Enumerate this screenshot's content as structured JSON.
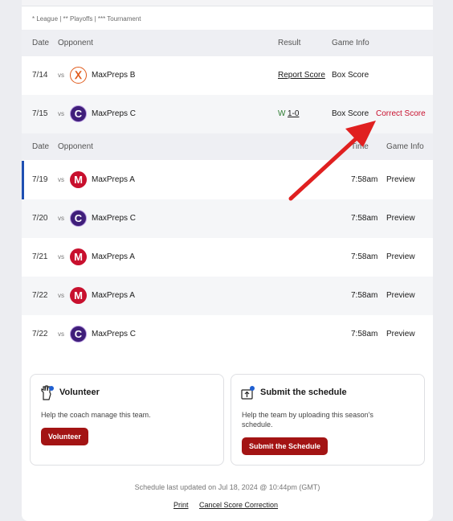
{
  "legend": "* League | ** Playoffs | *** Tournament",
  "results_header": {
    "date": "Date",
    "opponent": "Opponent",
    "result": "Result",
    "game_info": "Game Info"
  },
  "results": [
    {
      "date": "7/14",
      "vs": "vs",
      "opponent": "MaxPreps B",
      "result_link": "Report Score",
      "box": "Box Score"
    },
    {
      "date": "7/15",
      "vs": "vs",
      "opponent": "MaxPreps C",
      "result_prefix": "W",
      "result_score": "1-0",
      "box": "Box Score",
      "correct": "Correct Score"
    }
  ],
  "upcoming_header": {
    "date": "Date",
    "opponent": "Opponent",
    "time": "Time",
    "game_info": "Game Info"
  },
  "upcoming": [
    {
      "date": "7/19",
      "vs": "vs",
      "opponent": "MaxPreps A",
      "logo": "M",
      "time": "7:58am",
      "info": "Preview"
    },
    {
      "date": "7/20",
      "vs": "vs",
      "opponent": "MaxPreps C",
      "logo": "C",
      "time": "7:58am",
      "info": "Preview"
    },
    {
      "date": "7/21",
      "vs": "vs",
      "opponent": "MaxPreps A",
      "logo": "M",
      "time": "7:58am",
      "info": "Preview"
    },
    {
      "date": "7/22",
      "vs": "vs",
      "opponent": "MaxPreps A",
      "logo": "M",
      "time": "7:58am",
      "info": "Preview"
    },
    {
      "date": "7/22",
      "vs": "vs",
      "opponent": "MaxPreps C",
      "logo": "C",
      "time": "7:58am",
      "info": "Preview"
    }
  ],
  "volunteer": {
    "title": "Volunteer",
    "desc": "Help the coach manage this team.",
    "button": "Volunteer"
  },
  "submit": {
    "title": "Submit the schedule",
    "desc_line1": "Help the team by uploading this season's",
    "desc_line2": "schedule.",
    "button": "Submit the Schedule"
  },
  "updated": "Schedule last updated on Jul 18, 2024 @ 10:44pm (GMT)",
  "footer": {
    "print": "Print",
    "cancel": "Cancel Score Correction"
  },
  "logos": {
    "b": "Ⅹ",
    "c": "C",
    "m": "M"
  },
  "colors": {
    "accent_red": "#a31414",
    "correct_score": "#c8102e",
    "win_green": "#2e7d32",
    "highlight_bar": "#1f4fb2"
  }
}
